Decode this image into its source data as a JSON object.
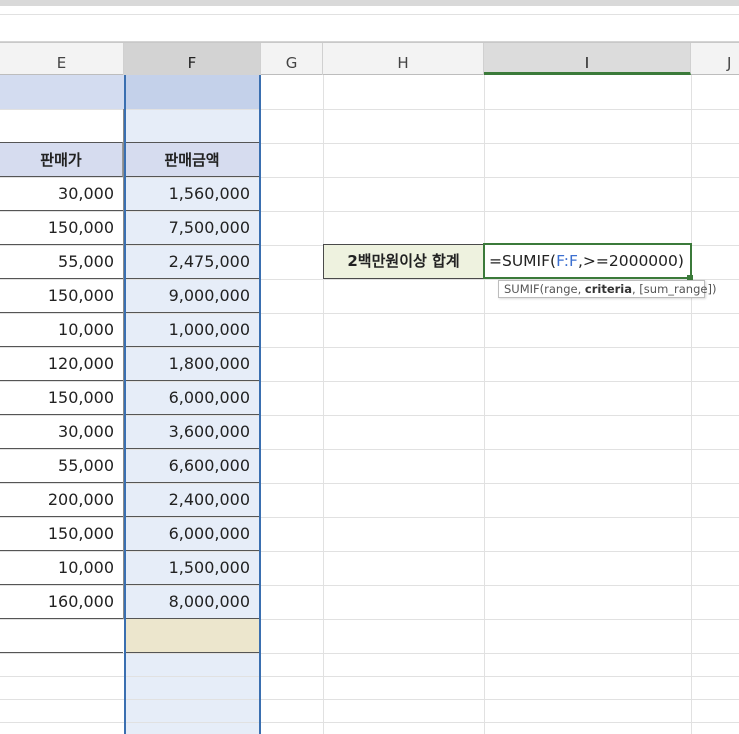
{
  "columns": [
    "E",
    "F",
    "G",
    "H",
    "I",
    "J"
  ],
  "table": {
    "headers": {
      "price": "판매가",
      "amount": "판매금액"
    },
    "rows": [
      {
        "price": "30,000",
        "amount": "1,560,000"
      },
      {
        "price": "150,000",
        "amount": "7,500,000"
      },
      {
        "price": "55,000",
        "amount": "2,475,000"
      },
      {
        "price": "150,000",
        "amount": "9,000,000"
      },
      {
        "price": "10,000",
        "amount": "1,000,000"
      },
      {
        "price": "120,000",
        "amount": "1,800,000"
      },
      {
        "price": "150,000",
        "amount": "6,000,000"
      },
      {
        "price": "30,000",
        "amount": "3,600,000"
      },
      {
        "price": "55,000",
        "amount": "6,600,000"
      },
      {
        "price": "200,000",
        "amount": "2,400,000"
      },
      {
        "price": "150,000",
        "amount": "6,000,000"
      },
      {
        "price": "10,000",
        "amount": "1,500,000"
      },
      {
        "price": "160,000",
        "amount": "8,000,000"
      }
    ]
  },
  "summary": {
    "label": "2백만원이상 합계",
    "formula_prefix": "=SUMIF(",
    "formula_ref": "F:F",
    "formula_rest": ",>=2000000)",
    "tooltip_func": "SUMIF(range, ",
    "tooltip_bold": "criteria",
    "tooltip_rest": ", [sum_range])"
  },
  "colors": {
    "column_f_selection": "#e6edf8",
    "header_fill": "#d6dcef",
    "title_band": "#d3dcf0",
    "total_cell": "#ece6cd",
    "label_fill": "#eef2df",
    "active_border": "#3b7a3a",
    "selection_border": "#3a6fb0",
    "ref_blue": "#3c6fd0"
  }
}
